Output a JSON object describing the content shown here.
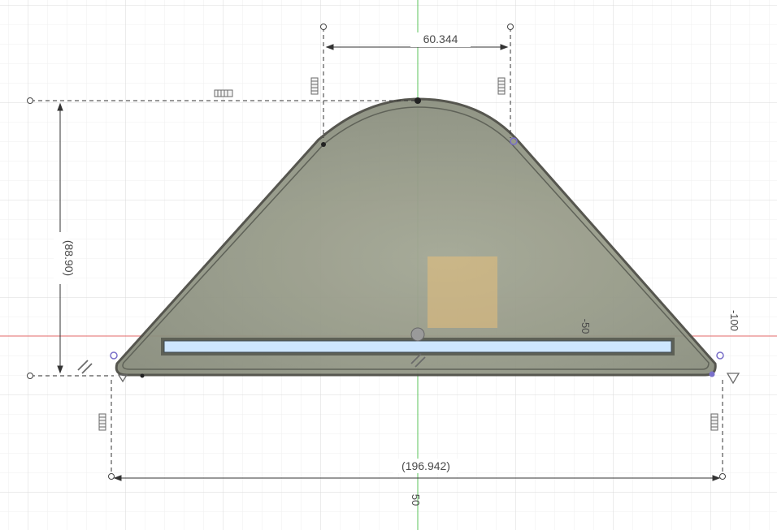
{
  "dimensions": {
    "top_width": "60.344",
    "height": "(88.90)",
    "base_width": "(196.942)"
  },
  "axis_labels": {
    "x_neg50": "-50",
    "x_neg100": "-100",
    "y_50": "50"
  },
  "colors": {
    "background": "#ffffff",
    "grid_minor": "#efefef",
    "grid_major": "#d9d9d9",
    "body_fill": "#8f9383",
    "body_edge": "#4d4d46",
    "dimension_line": "#333333",
    "x_axis": "#e36a6a",
    "y_axis": "#5bc35b",
    "slot_fill": "#cde6ff",
    "origin_marker": "#e8c07a",
    "constraint_icon": "#6a6a6a",
    "endpoint_marker": "#7a70c9"
  }
}
